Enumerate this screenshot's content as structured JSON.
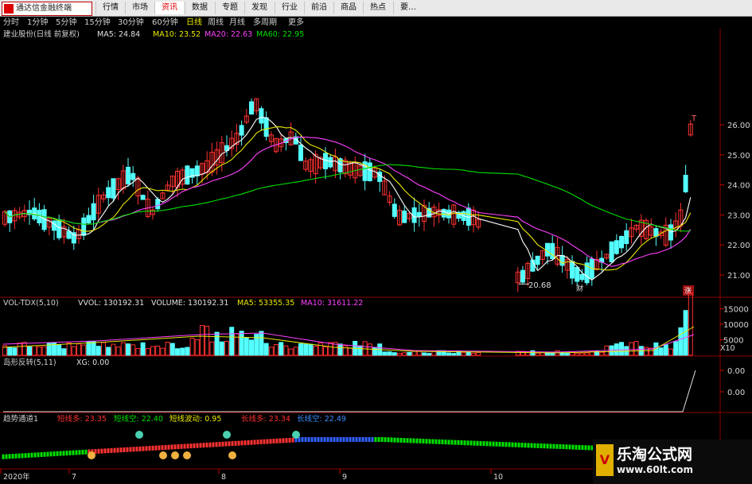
{
  "app": {
    "name": "通达信金融终端"
  },
  "menu": [
    "行情",
    "市场",
    "资讯",
    "数据",
    "专题",
    "发现",
    "行业",
    "前沿",
    "商品",
    "热点",
    "要…"
  ],
  "menu_active_index": 2,
  "periods": [
    "分时",
    "1分钟",
    "5分钟",
    "15分钟",
    "30分钟",
    "60分钟",
    "日线",
    "周线",
    "月线",
    "多周期",
    "更多"
  ],
  "period_active_index": 6,
  "main_panel": {
    "stock": "建业股份(日线 前复权)",
    "ma5": "MA5: 24.84",
    "ma10": "MA10: 23.52",
    "ma20": "MA20: 22.63",
    "ma60": "MA60: 22.95",
    "y_ticks": [
      "26.00",
      "25.00",
      "24.00",
      "23.00",
      "22.00",
      "21.00"
    ],
    "low_marker": "20.68",
    "event_labels": [
      "财",
      "涨",
      "T"
    ]
  },
  "vol_panel": {
    "name": "VOL-TDX(5,10)",
    "vvol": "VVOL: 130192.31",
    "volume": "VOLUME: 130192.31",
    "ma5": "MA5: 53355.35",
    "ma10": "MA10: 31611.22",
    "y_ticks": [
      "15000",
      "10000",
      "5000"
    ],
    "unit": "X10"
  },
  "island_panel": {
    "name": "岛形反转(5,11)",
    "xg": "XG: 0.00",
    "y_ticks": [
      "0.00",
      "0.00"
    ]
  },
  "trend_panel": {
    "name": "趋势通道1",
    "short_long": "短线多: 23.35",
    "short_short": "短线空: 22.40",
    "short_wave": "短线波动: 0.95",
    "long_long": "长线多: 23.34",
    "long_short": "长线空: 22.49"
  },
  "x_axis": {
    "labels": [
      "2020年",
      "7",
      "8",
      "9",
      "10"
    ]
  },
  "watermark": {
    "title": "乐淘公式网",
    "url": "www.60lt.com",
    "badge": "V"
  },
  "colors": {
    "up": "#ff3232",
    "down": "#54ffff",
    "ma5": "#ffffff",
    "ma10": "#e8e800",
    "ma20": "#ff40ff",
    "ma60": "#00e000",
    "grid": "#8b0000"
  }
}
